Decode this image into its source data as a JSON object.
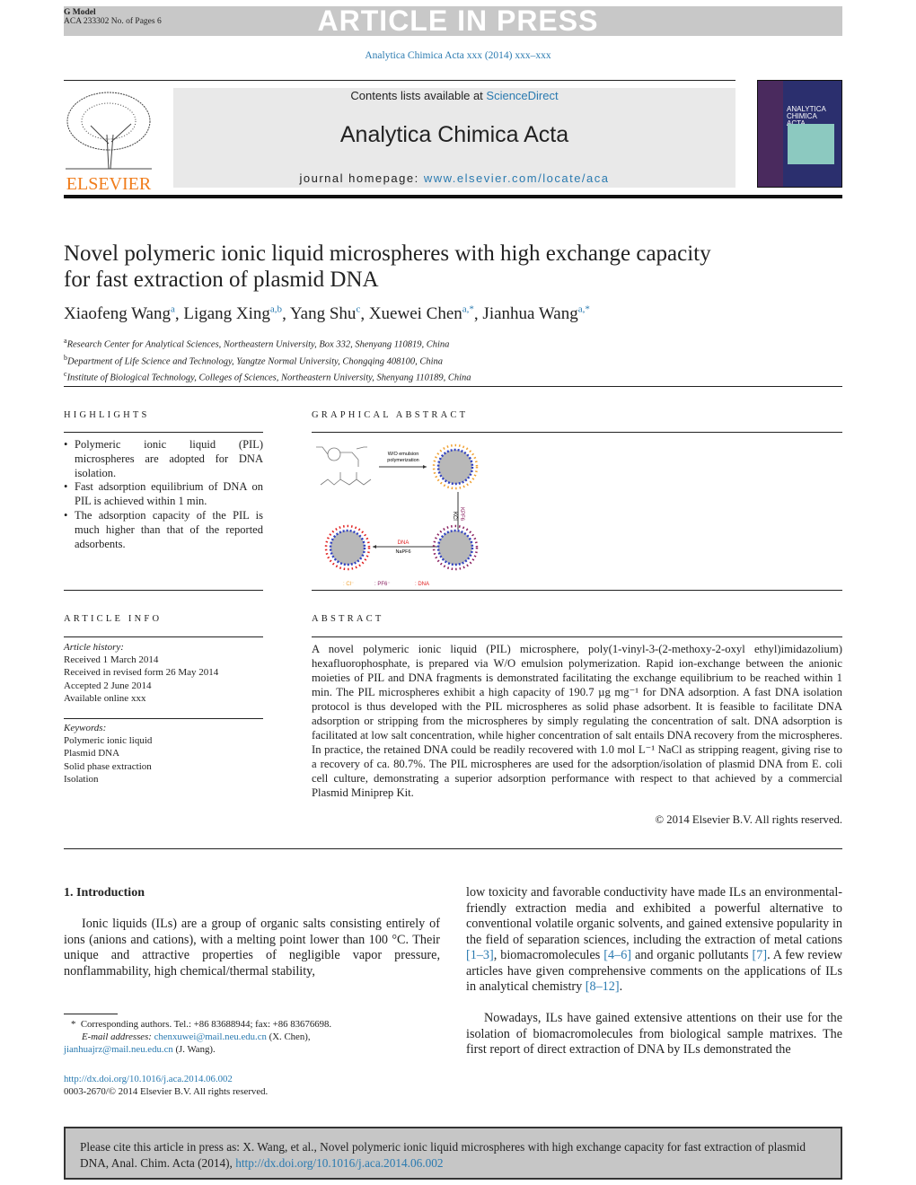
{
  "header": {
    "model": "G Model",
    "article_id": "ACA 233302 No. of Pages 6",
    "banner": "ARTICLE IN PRESS",
    "journal_ref": "Analytica Chimica Acta xxx (2014) xxx–xxx",
    "contents_prefix": "Contents lists available at ",
    "sciencedirect": "ScienceDirect",
    "journal_name": "Analytica Chimica Acta",
    "homepage_prefix": "journal homepage: ",
    "homepage_url": "www.elsevier.com/locate/aca",
    "publisher_logo": "ELSEVIER",
    "cover_title": "ANALYTICA CHIMICA ACTA"
  },
  "article": {
    "title_line1": "Novel polymeric ionic liquid microspheres with high exchange capacity",
    "title_line2": "for fast extraction of plasmid DNA",
    "authors": [
      {
        "name": "Xiaofeng Wang",
        "sup": "a"
      },
      {
        "name": "Ligang Xing",
        "sup": "a,b"
      },
      {
        "name": "Yang Shu",
        "sup": "c"
      },
      {
        "name": "Xuewei Chen",
        "sup": "a,*"
      },
      {
        "name": "Jianhua Wang",
        "sup": "a,*"
      }
    ],
    "affiliations": [
      {
        "sup": "a",
        "text": "Research Center for Analytical Sciences, Northeastern University, Box 332, Shenyang 110819, China"
      },
      {
        "sup": "b",
        "text": "Department of Life Science and Technology, Yangtze Normal University, Chongqing 408100, China"
      },
      {
        "sup": "c",
        "text": "Institute of Biological Technology, Colleges of Sciences, Northeastern University, Shenyang 110189, China"
      }
    ]
  },
  "highlights": {
    "heading": "HIGHLIGHTS",
    "items": [
      "Polymeric ionic liquid (PIL) microspheres are adopted for DNA isolation.",
      "Fast adsorption equilibrium of DNA on PIL is achieved within 1 min.",
      "The adsorption capacity of the PIL is much higher than that of the reported adsorbents."
    ]
  },
  "graphical_abstract": {
    "heading": "GRAPHICAL ABSTRACT",
    "step1": "W/O emulsion",
    "step1b": "polymerization",
    "step2a": "KCl",
    "step2b": "KPF6",
    "step3a": "DNA",
    "step3b": "NaPF6",
    "legend_cl": ": Cl⁻",
    "legend_pf6": ": PF6⁻",
    "legend_dna": ": DNA",
    "colors": {
      "cl": "#f0a030",
      "pf6": "#8a2060",
      "dna": "#e02020",
      "core": "#b8b8b8",
      "shell": "#3040c0"
    }
  },
  "article_info": {
    "heading": "ARTICLE INFO",
    "history_label": "Article history:",
    "history": [
      "Received 1 March 2014",
      "Received in revised form 26 May 2014",
      "Accepted 2 June 2014",
      "Available online xxx"
    ],
    "keywords_label": "Keywords:",
    "keywords": [
      "Polymeric ionic liquid",
      "Plasmid DNA",
      "Solid phase extraction",
      "Isolation"
    ]
  },
  "abstract": {
    "heading": "ABSTRACT",
    "text": "A novel polymeric ionic liquid (PIL) microsphere, poly(1-vinyl-3-(2-methoxy-2-oxyl ethyl)imidazolium) hexafluorophosphate, is prepared via W/O emulsion polymerization. Rapid ion-exchange between the anionic moieties of PIL and DNA fragments is demonstrated facilitating the exchange equilibrium to be reached within 1 min. The PIL microspheres exhibit a high capacity of 190.7 µg mg⁻¹ for DNA adsorption. A fast DNA isolation protocol is thus developed with the PIL microspheres as solid phase adsorbent. It is feasible to facilitate DNA adsorption or stripping from the microspheres by simply regulating the concentration of salt. DNA adsorption is facilitated at low salt concentration, while higher concentration of salt entails DNA recovery from the microspheres. In practice, the retained DNA could be readily recovered with 1.0 mol L⁻¹ NaCl as stripping reagent, giving rise to a recovery of ca. 80.7%. The PIL microspheres are used for the adsorption/isolation of plasmid DNA from E. coli cell culture, demonstrating a superior adsorption performance with respect to that achieved by a commercial Plasmid Miniprep Kit.",
    "copyright": "© 2014 Elsevier B.V. All rights reserved."
  },
  "intro": {
    "heading": "1. Introduction",
    "p1": "Ionic liquids (ILs) are a group of organic salts consisting entirely of ions (anions and cations), with a melting point lower than 100 °C. Their unique and attractive properties of negligible vapor pressure, nonflammability, high chemical/thermal stability,",
    "p1_cont_a": "low toxicity and favorable conductivity have made ILs an environmental-friendly extraction media and exhibited a powerful alternative to conventional volatile organic solvents, and gained extensive popularity in the field of separation sciences, including the extraction of metal cations ",
    "ref1": "[1–3]",
    "p1_cont_b": ", biomacromolecules ",
    "ref2": "[4–6]",
    "p1_cont_c": " and organic pollutants ",
    "ref3": "[7]",
    "p1_cont_d": ". A few review articles have given comprehensive comments on the applications of ILs in analytical chemistry ",
    "ref4": "[8–12]",
    "p1_cont_e": ".",
    "p2": "Nowadays, ILs have gained extensive attentions on their use for the isolation of biomacromolecules from biological sample matrixes. The first report of direct extraction of DNA by ILs demonstrated the"
  },
  "footnote": {
    "star": "*",
    "corr": "Corresponding authors. Tel.: +86 83688944; fax: +86 83676698.",
    "email_label": "E-mail addresses: ",
    "email1": "chenxuwei@mail.neu.edu.cn",
    "email1_name": " (X. Chen),",
    "email2": "jianhuajrz@mail.neu.edu.cn",
    "email2_name": " (J. Wang).",
    "doi": "http://dx.doi.org/10.1016/j.aca.2014.06.002",
    "issn": "0003-2670/© 2014 Elsevier B.V. All rights reserved."
  },
  "citation": {
    "text": "Please cite this article in press as: X. Wang, et al., Novel polymeric ionic liquid microspheres with high exchange capacity for fast extraction of plasmid DNA, Anal. Chim. Acta (2014), ",
    "doi": "http://dx.doi.org/10.1016/j.aca.2014.06.002"
  }
}
